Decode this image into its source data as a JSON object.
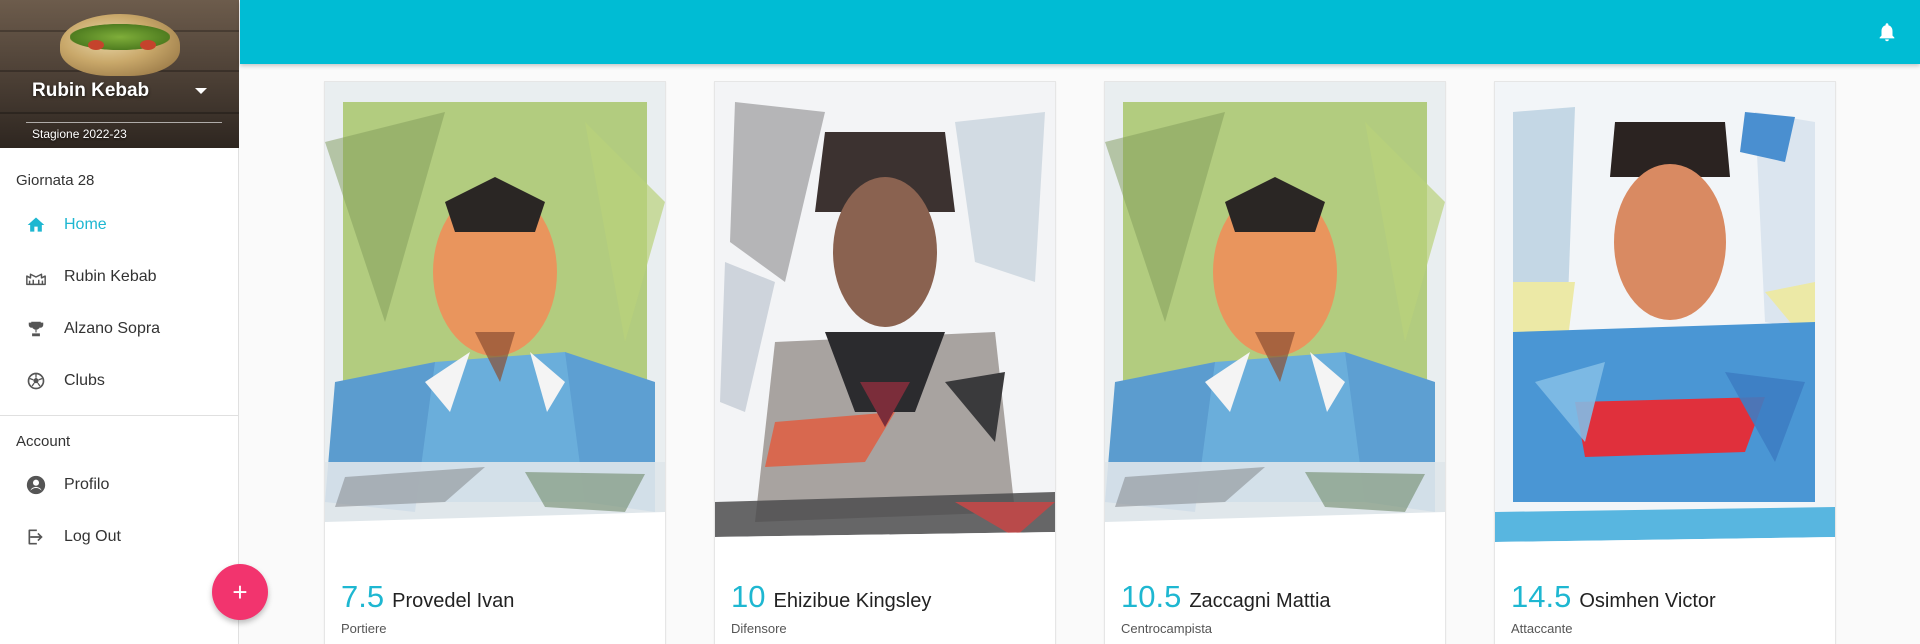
{
  "sidebar": {
    "team_name": "Rubin Kebab",
    "season": "Stagione 2022-23",
    "section_round": "Giornata 28",
    "nav": [
      {
        "label": "Home",
        "icon": "home-icon",
        "active": true
      },
      {
        "label": "Rubin Kebab",
        "icon": "stadium-icon",
        "active": false
      },
      {
        "label": "Alzano Sopra",
        "icon": "trophy-icon",
        "active": false
      },
      {
        "label": "Clubs",
        "icon": "soccer-ball-icon",
        "active": false
      }
    ],
    "section_account": "Account",
    "account_nav": [
      {
        "label": "Profilo",
        "icon": "account-circle-icon"
      },
      {
        "label": "Log Out",
        "icon": "logout-icon"
      }
    ]
  },
  "fab": {
    "label": "+",
    "icon": "plus-icon"
  },
  "topbar": {
    "color": "#00bcd4",
    "icon": "bell-icon"
  },
  "accent": "#1eb7d1",
  "players": [
    {
      "score": "7.5",
      "name": "Provedel Ivan",
      "role": "Portiere"
    },
    {
      "score": "10",
      "name": "Ehizibue Kingsley",
      "role": "Difensore"
    },
    {
      "score": "10.5",
      "name": "Zaccagni Mattia",
      "role": "Centrocampista"
    },
    {
      "score": "14.5",
      "name": "Osimhen Victor",
      "role": "Attaccante"
    }
  ]
}
